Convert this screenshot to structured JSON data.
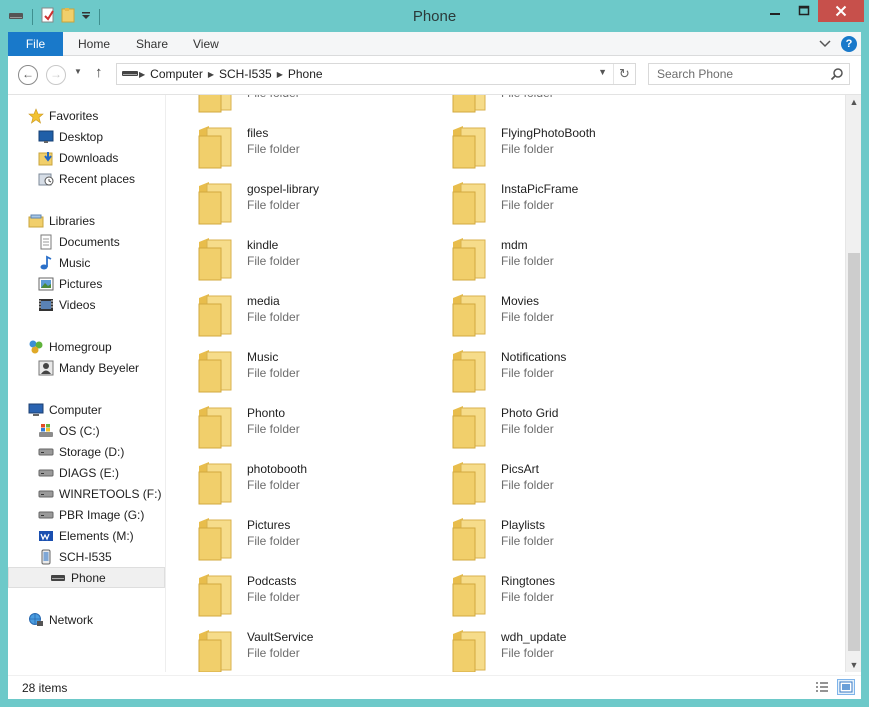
{
  "window": {
    "title": "Phone",
    "colors": {
      "frame": "#6dc9c9",
      "close": "#c7504b",
      "file_tab": "#1979ca",
      "folder": "#f1cf6b"
    }
  },
  "ribbon": {
    "tabs": [
      {
        "label": "File"
      },
      {
        "label": "Home"
      },
      {
        "label": "Share"
      },
      {
        "label": "View"
      }
    ]
  },
  "address": {
    "crumbs": [
      "Computer",
      "SCH-I535",
      "Phone"
    ],
    "search_placeholder": "Search Phone"
  },
  "nav": {
    "favorites": {
      "label": "Favorites",
      "items": [
        "Desktop",
        "Downloads",
        "Recent places"
      ]
    },
    "libraries": {
      "label": "Libraries",
      "items": [
        "Documents",
        "Music",
        "Pictures",
        "Videos"
      ]
    },
    "homegroup": {
      "label": "Homegroup",
      "items": [
        "Mandy Beyeler"
      ]
    },
    "computer": {
      "label": "Computer",
      "items": [
        "OS (C:)",
        "Storage (D:)",
        "DIAGS (E:)",
        "WINRETOOLS (F:)",
        "PBR Image (G:)",
        "Elements (M:)",
        "SCH-I535"
      ],
      "sub_item": "Phone"
    },
    "network": {
      "label": "Network"
    }
  },
  "content": {
    "top_partial_type": "File folder",
    "items": [
      {
        "name": "files",
        "type": "File folder"
      },
      {
        "name": "FlyingPhotoBooth",
        "type": "File folder"
      },
      {
        "name": "gospel-library",
        "type": "File folder"
      },
      {
        "name": "InstaPicFrame",
        "type": "File folder"
      },
      {
        "name": "kindle",
        "type": "File folder"
      },
      {
        "name": "mdm",
        "type": "File folder"
      },
      {
        "name": "media",
        "type": "File folder"
      },
      {
        "name": "Movies",
        "type": "File folder"
      },
      {
        "name": "Music",
        "type": "File folder"
      },
      {
        "name": "Notifications",
        "type": "File folder"
      },
      {
        "name": "Phonto",
        "type": "File folder"
      },
      {
        "name": "Photo Grid",
        "type": "File folder"
      },
      {
        "name": "photobooth",
        "type": "File folder"
      },
      {
        "name": "PicsArt",
        "type": "File folder"
      },
      {
        "name": "Pictures",
        "type": "File folder"
      },
      {
        "name": "Playlists",
        "type": "File folder"
      },
      {
        "name": "Podcasts",
        "type": "File folder"
      },
      {
        "name": "Ringtones",
        "type": "File folder"
      },
      {
        "name": "VaultService",
        "type": "File folder"
      },
      {
        "name": "wdh_update",
        "type": "File folder"
      }
    ]
  },
  "status": {
    "count": "28 items"
  }
}
